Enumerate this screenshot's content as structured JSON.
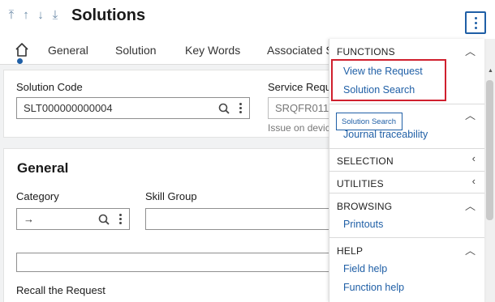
{
  "header": {
    "title": "Solutions",
    "nav_arrows": [
      "⤒",
      "↑",
      "↓",
      "⤓"
    ]
  },
  "tabs": [
    {
      "label": "General"
    },
    {
      "label": "Solution"
    },
    {
      "label": "Key Words"
    },
    {
      "label": "Associated S"
    }
  ],
  "solution_code": {
    "label": "Solution Code",
    "value": "SLT000000000004"
  },
  "service_request": {
    "label": "Service Requ",
    "value": "SRQFR011",
    "hint": "Issue on devic"
  },
  "general": {
    "title": "General",
    "category_label": "Category",
    "category_value": "→",
    "skill_group_label": "Skill Group",
    "recall_label": "Recall the Request"
  },
  "panel": {
    "functions": {
      "title": "FUNCTIONS",
      "items": [
        "View the Request",
        "Solution Search"
      ]
    },
    "tooltip": "Solution Search",
    "traceability": {
      "items": [
        "Journal traceability"
      ]
    },
    "selection": {
      "title": "SELECTION"
    },
    "utilities": {
      "title": "UTILITIES"
    },
    "browsing": {
      "title": "BROWSING",
      "items": [
        "Printouts"
      ]
    },
    "help": {
      "title": "HELP",
      "items": [
        "Field help",
        "Function help"
      ]
    }
  },
  "colors": {
    "accent": "#1f5fa6",
    "highlight": "#d0202e"
  }
}
